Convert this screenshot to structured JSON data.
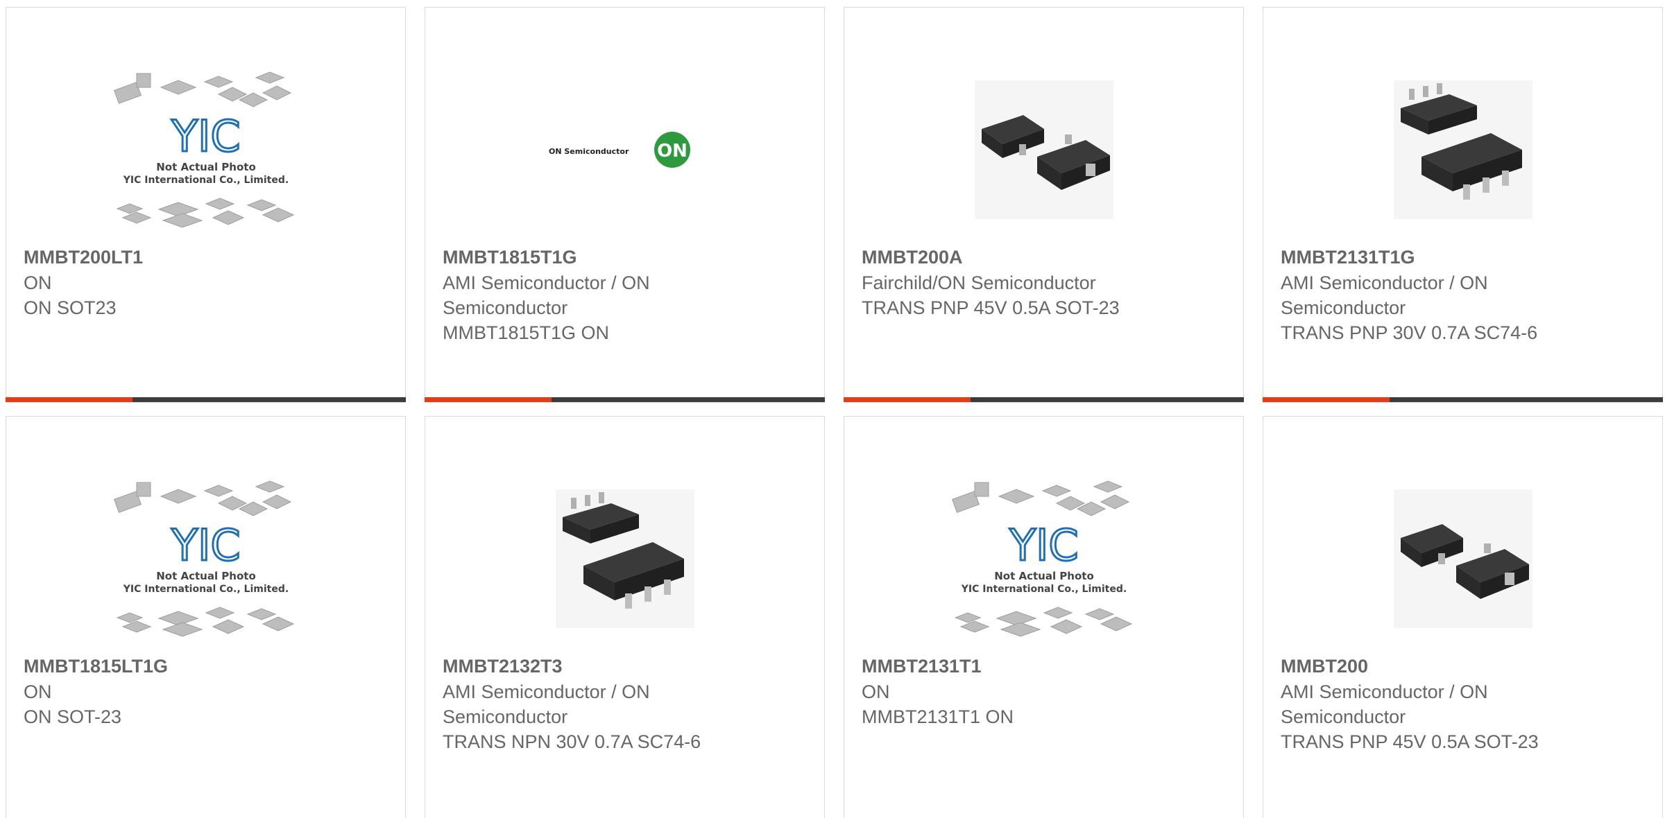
{
  "products": [
    {
      "part": "MMBT200LT1",
      "mfr_lines": [
        "ON"
      ],
      "desc": "ON SOT23",
      "image": "placeholder-logo"
    },
    {
      "part": "MMBT1815T1G",
      "mfr_lines": [
        "AMI Semiconductor / ON",
        "Semiconductor"
      ],
      "desc": "MMBT1815T1G ON",
      "image": "on-semiconductor-logo"
    },
    {
      "part": "MMBT200A",
      "mfr_lines": [
        "Fairchild/ON Semiconductor"
      ],
      "desc": "TRANS PNP 45V 0.5A SOT-23",
      "image": "sot23-package"
    },
    {
      "part": "MMBT2131T1G",
      "mfr_lines": [
        "AMI Semiconductor / ON",
        "Semiconductor"
      ],
      "desc": "TRANS PNP 30V 0.7A SC74-6",
      "image": "sc74-package"
    },
    {
      "part": "MMBT1815LT1G",
      "mfr_lines": [
        "ON"
      ],
      "desc": "ON SOT-23",
      "image": "placeholder-logo"
    },
    {
      "part": "MMBT2132T3",
      "mfr_lines": [
        "AMI Semiconductor / ON",
        "Semiconductor"
      ],
      "desc": "TRANS NPN 30V 0.7A SC74-6",
      "image": "sc74-package"
    },
    {
      "part": "MMBT2131T1",
      "mfr_lines": [
        "ON"
      ],
      "desc": "MMBT2131T1 ON",
      "image": "placeholder-logo"
    },
    {
      "part": "MMBT200",
      "mfr_lines": [
        "AMI Semiconductor / ON",
        "Semiconductor"
      ],
      "desc": "TRANS PNP 45V 0.5A SOT-23",
      "image": "sot23-package"
    }
  ],
  "placeholder": {
    "brand": "YIC",
    "line1": "Not Actual Photo",
    "line2": "YIC International Co., Limited."
  },
  "on_logo": {
    "wordmark": "ON Semiconductor",
    "badge": "ON"
  },
  "colors": {
    "accent": "#e23d14",
    "bar": "#3c3c3c",
    "text": "#666666",
    "yic_blue": "#1f6fb5",
    "on_green": "#2e9a3e"
  }
}
